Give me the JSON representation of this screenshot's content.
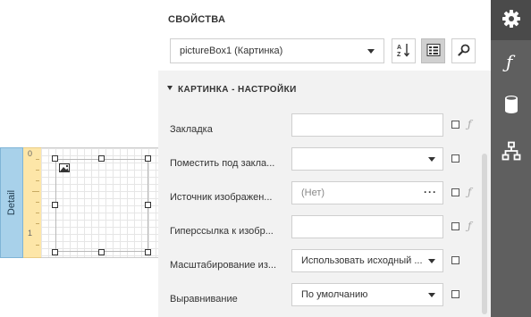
{
  "designer": {
    "band_label": "Detail",
    "ruler_marks": [
      "0",
      "1"
    ]
  },
  "panel": {
    "title": "СВОЙСТВА",
    "object_selector": "pictureBox1 (Картинка)",
    "section_title": "КАРТИНКА - НАСТРОЙКИ",
    "properties": [
      {
        "label": "Закладка",
        "value": "",
        "placeholder": "",
        "editor": "text",
        "has_expression": true
      },
      {
        "label": "Поместить под закла...",
        "value": "",
        "placeholder": "",
        "editor": "dropdown",
        "has_expression": false
      },
      {
        "label": "Источник изображен...",
        "value": "",
        "placeholder": "(Нет)",
        "editor": "ellipsis",
        "has_expression": true
      },
      {
        "label": "Гиперссылка к изобр...",
        "value": "",
        "placeholder": "",
        "editor": "text",
        "has_expression": true
      },
      {
        "label": "Масштабирование из...",
        "value": "Использовать исходный ...",
        "placeholder": "",
        "editor": "dropdown",
        "has_expression": false
      },
      {
        "label": "Выравнивание",
        "value": "По умолчанию",
        "placeholder": "",
        "editor": "dropdown",
        "has_expression": false
      }
    ]
  },
  "sidebar": {
    "items": [
      {
        "icon": "gear-icon",
        "active": true
      },
      {
        "icon": "function-icon",
        "active": false
      },
      {
        "icon": "database-icon",
        "active": false
      },
      {
        "icon": "hierarchy-icon",
        "active": false
      }
    ]
  },
  "colors": {
    "band_tab": "#a8d1ea",
    "ruler": "#fde6a8",
    "sidebar": "#5f5f5f",
    "panel_rows": "#f2f2f2"
  }
}
